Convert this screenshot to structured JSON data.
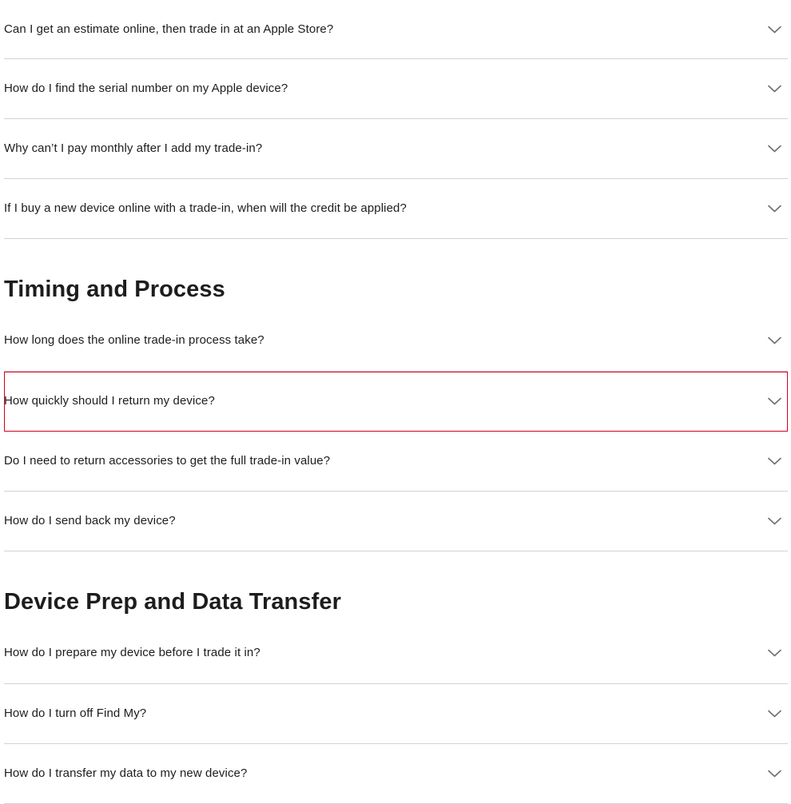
{
  "sections": [
    {
      "title": "",
      "items": [
        "Can I get an estimate online, then trade in at an Apple Store?",
        "How do I find the serial number on my Apple device?",
        "Why can’t I pay monthly after I add my trade-in?",
        "If I buy a new device online with a trade-in, when will the credit be applied?"
      ]
    },
    {
      "title": "Timing and Process",
      "items": [
        "How long does the online trade-in process take?",
        "How quickly should I return my device?",
        "Do I need to return accessories to get the full trade-in value?",
        "How do I send back my device?"
      ]
    },
    {
      "title": "Device Prep and Data Transfer",
      "items": [
        "How do I prepare my device before I trade it in?",
        "How do I turn off Find My?",
        "How do I transfer my data to my new device?"
      ]
    }
  ],
  "highlighted_item": "How quickly should I return my device?",
  "icons": {
    "expand": "chevron-down-icon"
  },
  "colors": {
    "text": "#1d1d1f",
    "divider": "#d2d2d7",
    "chevron": "#6e6e73",
    "highlight": "#d0021b"
  }
}
